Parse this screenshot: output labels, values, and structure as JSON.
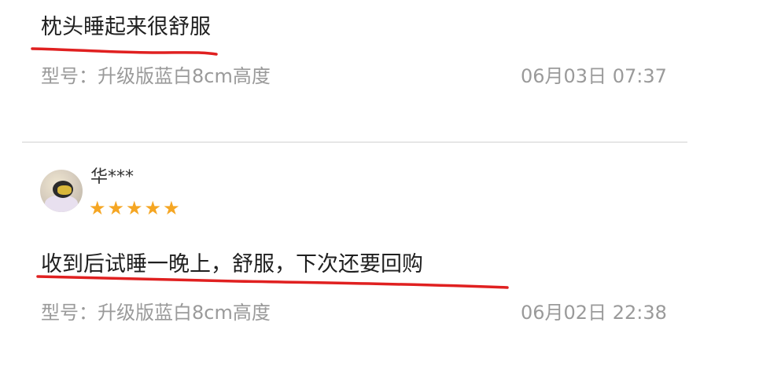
{
  "reviews": [
    {
      "text": "枕头睡起来很舒服",
      "model": "型号：升级版蓝白8cm高度",
      "time": "06月03日 07:37"
    },
    {
      "user": "华***",
      "stars": [
        "★",
        "★",
        "★",
        "★",
        "★"
      ],
      "text": "收到后试睡一晚上，舒服，下次还要回购",
      "model": "型号：升级版蓝白8cm高度",
      "time": "06月02日 22:38"
    }
  ],
  "colors": {
    "star": "#f5a623",
    "underline": "#e02020"
  },
  "icons": {
    "star": "star-icon",
    "avatar": "user-avatar"
  }
}
